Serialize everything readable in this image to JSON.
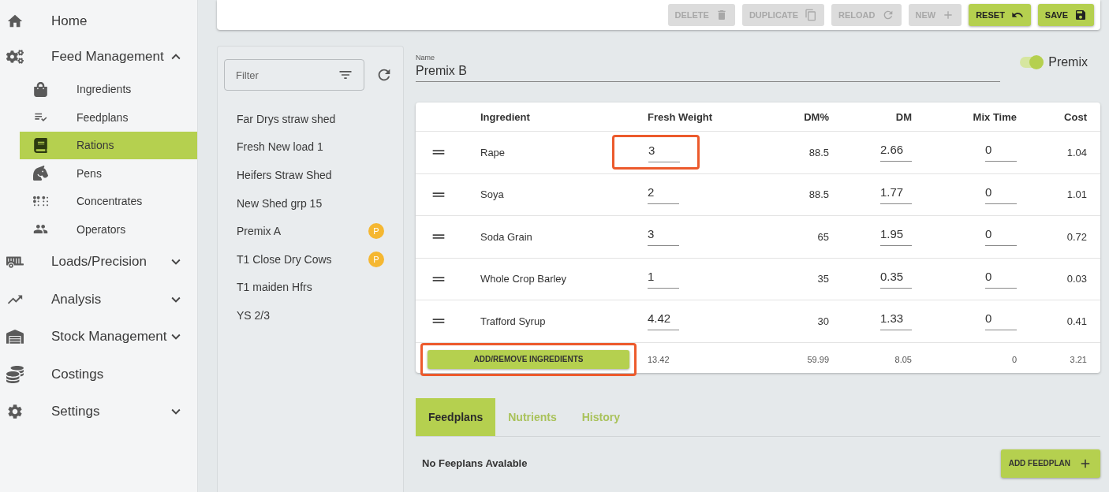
{
  "sidebar": {
    "items": [
      {
        "kind": "home",
        "label": "Home"
      },
      {
        "kind": "feed",
        "label": "Feed Management",
        "expanded": true,
        "children": [
          {
            "kind": "ingredients",
            "label": "Ingredients",
            "selected": false
          },
          {
            "kind": "feedplans",
            "label": "Feedplans",
            "selected": false
          },
          {
            "kind": "rations",
            "label": "Rations",
            "selected": true
          },
          {
            "kind": "pens",
            "label": "Pens",
            "selected": false
          },
          {
            "kind": "concentrates",
            "label": "Concentrates",
            "selected": false
          },
          {
            "kind": "operators",
            "label": "Operators",
            "selected": false
          }
        ]
      },
      {
        "kind": "loads",
        "label": "Loads/Precision",
        "expanded": false
      },
      {
        "kind": "analysis",
        "label": "Analysis",
        "expanded": false
      },
      {
        "kind": "stock",
        "label": "Stock Management",
        "expanded": false
      },
      {
        "kind": "costings",
        "label": "Costings"
      },
      {
        "kind": "settings",
        "label": "Settings",
        "expanded": false
      }
    ]
  },
  "toolbar": [
    {
      "kind": "delete",
      "label": "DELETE",
      "disabled": true
    },
    {
      "kind": "duplicate",
      "label": "DUPLICATE",
      "disabled": true
    },
    {
      "kind": "reload",
      "label": "RELOAD",
      "disabled": true
    },
    {
      "kind": "new",
      "label": "NEW",
      "disabled": true
    },
    {
      "kind": "reset",
      "label": "RESET",
      "disabled": false
    },
    {
      "kind": "save",
      "label": "SAVE",
      "disabled": false
    }
  ],
  "list": {
    "filter_placeholder": "Filter",
    "items": [
      {
        "label": "Far Drys straw shed"
      },
      {
        "label": "Fresh New load 1"
      },
      {
        "label": "Heifers Straw Shed"
      },
      {
        "label": "New Shed grp 15"
      },
      {
        "label": "Premix A",
        "badge": "P"
      },
      {
        "label": "T1 Close Dry Cows",
        "badge": "P"
      },
      {
        "label": "T1 maiden Hfrs"
      },
      {
        "label": "YS 2/3"
      }
    ]
  },
  "ration": {
    "name_label": "Name",
    "name": "Premix B",
    "premix": {
      "label": "Premix",
      "on": true
    }
  },
  "table": {
    "columns": [
      "Ingredient",
      "Fresh Weight",
      "DM%",
      "DM",
      "Mix Time",
      "Cost"
    ],
    "rows": [
      {
        "name": "Rape",
        "fresh_weight": "3",
        "dm_pct": "88.5",
        "dm": "2.66",
        "mix_time": "0",
        "cost": "1.04",
        "highlighted": true
      },
      {
        "name": "Soya",
        "fresh_weight": "2",
        "dm_pct": "88.5",
        "dm": "1.77",
        "mix_time": "0",
        "cost": "1.01",
        "highlighted": false
      },
      {
        "name": "Soda Grain",
        "fresh_weight": "3",
        "dm_pct": "65",
        "dm": "1.95",
        "mix_time": "0",
        "cost": "0.72",
        "highlighted": false
      },
      {
        "name": "Whole Crop Barley",
        "fresh_weight": "1",
        "dm_pct": "35",
        "dm": "0.35",
        "mix_time": "0",
        "cost": "0.03",
        "highlighted": false
      },
      {
        "name": "Trafford Syrup",
        "fresh_weight": "4.42",
        "dm_pct": "30",
        "dm": "1.33",
        "mix_time": "0",
        "cost": "0.41",
        "highlighted": false
      }
    ],
    "add_button": {
      "label": "ADD/REMOVE INGREDIENTS",
      "highlighted": true
    },
    "totals": {
      "fresh_weight": "13.42",
      "dm_pct": "59.99",
      "dm": "8.05",
      "mix_time": "0",
      "cost": "3.21"
    }
  },
  "tabs": [
    {
      "label": "Feedplans",
      "selected": true
    },
    {
      "label": "Nutrients",
      "selected": false
    },
    {
      "label": "History",
      "selected": false
    }
  ],
  "feedplans": {
    "empty_text": "No Feeplans Avalable",
    "add_button": "ADD FEEDPLAN"
  }
}
